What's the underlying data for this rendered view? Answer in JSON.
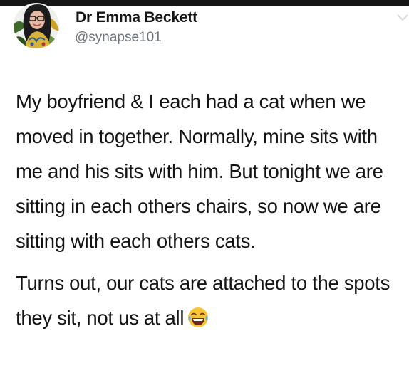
{
  "author": {
    "name": "Dr Emma Beckett",
    "handle": "@synapse101"
  },
  "icons": {
    "avatar": "profile-photo",
    "menu": "chevron-down-icon",
    "emoji": "face-with-tears-of-joy"
  },
  "tweet": {
    "paragraph1": "My boyfriend & I each had a cat when we moved in together. Normally, mine sits with me and his sits with him. But tonight we are sitting in each others chairs, so now we are sitting with each others cats.",
    "paragraph2": "Turns out, our cats are attached to the spots they sit, not us at all"
  }
}
